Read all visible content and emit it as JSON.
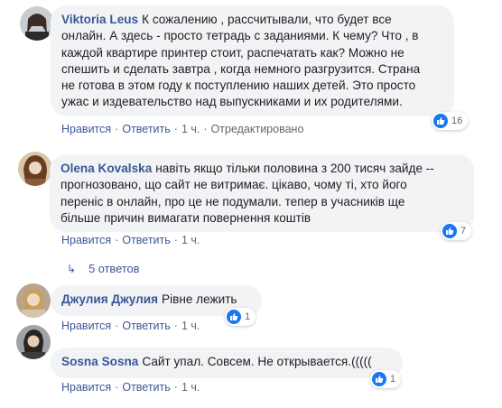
{
  "comments": [
    {
      "author": "Viktoria Leus",
      "lines": [
        "К сожалению , рассчитывали, что будет все",
        "онлайн. А здесь - просто тетрадь с заданиями. К чему? Что , в",
        "каждой квартире принтер стоит, распечатать как? Можно не",
        "спешить и сделать завтра , когда немного разгрузится. Страна",
        "не готова в этом году к поступлению наших детей. Это просто",
        "ужас и издевательство над выпускниками и их родителями."
      ],
      "reactions": "16",
      "like_label": "Нравится",
      "reply_label": "Ответить",
      "time": "1 ч.",
      "edited": "Отредактировано"
    },
    {
      "author": "Olena Kovalska",
      "lines": [
        "навіть якщо тільки половина з 200 тисяч зайде --",
        "прогнозовано, що сайт не витримає. цікаво, чому ті, хто його",
        "переніс в онлайн, про це не подумали. тепер в учасників ще",
        "більше причин вимагати повернення коштів"
      ],
      "reactions": "7",
      "like_label": "Нравится",
      "reply_label": "Ответить",
      "time": "1 ч.",
      "replies_label": "5 ответов"
    },
    {
      "author": "Джулия Джулия",
      "lines": [
        "Рівне лежить"
      ],
      "reactions": "1",
      "like_label": "Нравится",
      "reply_label": "Ответить",
      "time": "1 ч."
    },
    {
      "author": "Sosna Sosna",
      "lines": [
        "Сайт упал. Совсем. Не открывается.((((("
      ],
      "reactions": "1",
      "like_label": "Нравится",
      "reply_label": "Ответить",
      "time": "1 ч."
    }
  ],
  "colors": {
    "link": "#385898",
    "bubble": "#f2f3f5",
    "like_blue": "#1877f2",
    "meta": "#606770"
  },
  "icons": [
    "like-icon",
    "reply-arrow-icon",
    "avatar"
  ]
}
